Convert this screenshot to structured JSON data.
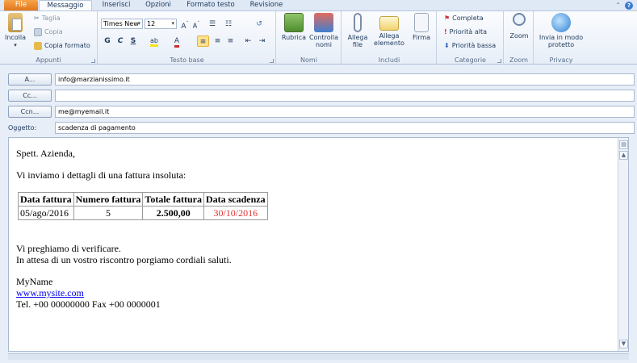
{
  "tabs": [
    "File",
    "Messaggio",
    "Inserisci",
    "Opzioni",
    "Formato testo",
    "Revisione"
  ],
  "ribbon": {
    "appunti": {
      "label": "Appunti",
      "paste": "Incolla",
      "cut": "Taglia",
      "copy": "Copia",
      "format_painter": "Copia formato"
    },
    "testo_base": {
      "label": "Testo base",
      "font": "Times New",
      "size": "12",
      "bold": "G",
      "italic": "C",
      "underline": "S"
    },
    "nomi": {
      "label": "Nomi",
      "rubrica": "Rubrica",
      "controlla": "Controlla nomi"
    },
    "includi": {
      "label": "Includi",
      "allega_file": "Allega file",
      "allega_elemento": "Allega elemento",
      "firma": "Firma"
    },
    "categorie": {
      "label": "Categorie",
      "completa": "Completa",
      "alta": "Priorità alta",
      "bassa": "Priorità bassa"
    },
    "zoom": {
      "label": "Zoom",
      "button": "Zoom"
    },
    "privacy": {
      "label": "Privacy",
      "button": "Invia in modo protetto"
    }
  },
  "fields": {
    "to_label": "A...",
    "to": "info@marzianissimo.it",
    "cc_label": "Cc...",
    "cc": "",
    "bcc_label": "Ccn...",
    "bcc": "me@myemail.it",
    "subject_label": "Oggetto:",
    "subject": "scadenza di pagamento"
  },
  "body": {
    "greeting": "Spett. Azienda,",
    "intro": "Vi inviamo i dettagli di una fattura insoluta:",
    "table": {
      "headers": [
        "Data fattura",
        "Numero fattura",
        "Totale fattura",
        "Data scadenza"
      ],
      "row": [
        "05/ago/2016",
        "5",
        "2.500,00",
        "30/10/2016"
      ]
    },
    "request": "Vi preghiamo di verificare.",
    "closing": "In attesa di un vostro riscontro porgiamo cordiali saluti.",
    "name": "MyName",
    "site": "www.mysite.com",
    "phone": "Tel. +00 00000000 Fax +00 0000001"
  }
}
